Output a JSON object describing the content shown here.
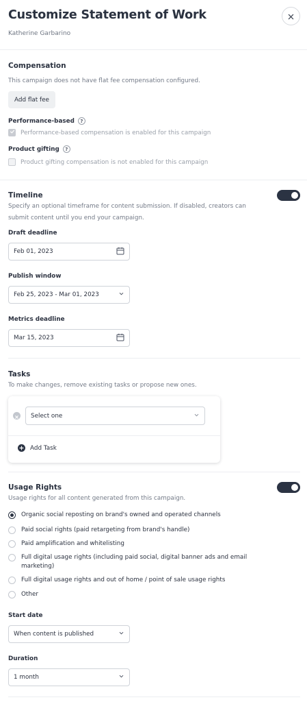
{
  "header": {
    "title": "Customize Statement of Work",
    "subtitle": "Katherine Garbarino"
  },
  "compensation": {
    "heading": "Compensation",
    "note": "This campaign does not have flat fee compensation configured.",
    "add_flat_fee_label": "Add flat fee",
    "performance_label": "Performance-based",
    "performance_status": "Performance-based compensation is enabled for this campaign",
    "gifting_label": "Product gifting",
    "gifting_status": "Product gifting compensation is not enabled for this campaign",
    "help_glyph": "?"
  },
  "timeline": {
    "heading": "Timeline",
    "enabled": true,
    "description_line1": "Specify an optional timeframe for content submission. If disabled, creators can",
    "description_line2": "submit content until you end your campaign.",
    "draft_label": "Draft deadline",
    "draft_value": "Feb 01, 2023",
    "publish_label": "Publish window",
    "publish_value": "Feb 25, 2023 - Mar 01, 2023",
    "metrics_label": "Metrics deadline",
    "metrics_value": "Mar 15, 2023"
  },
  "tasks": {
    "heading": "Tasks",
    "description": "To make changes, remove existing tasks or propose new ones.",
    "select_value": "Select one",
    "add_task_label": "Add Task"
  },
  "usage_rights": {
    "heading": "Usage Rights",
    "enabled": true,
    "description": "Usage rights for all content generated from this campaign.",
    "selected_index": 0,
    "options": [
      "Organic social reposting on brand's owned and operated channels",
      "Paid social rights (paid retargeting from brand's handle)",
      "Paid amplification and whitelisting",
      "Full digital usage rights (including paid social, digital banner ads and email marketing)",
      "Full digital usage rights and out of home / point of sale usage rights",
      "Other"
    ],
    "start_label": "Start date",
    "start_value": "When content is published",
    "duration_label": "Duration",
    "duration_value": "1 month"
  },
  "icons": {
    "close": "close-icon",
    "calendar": "calendar-icon",
    "chevron": "chevron-down-icon",
    "plus": "plus-circle-icon",
    "remove": "remove-circle-icon",
    "check": "checkmark-icon"
  },
  "colors": {
    "primary": "#2b3343",
    "muted_text": "#737a87",
    "border": "#cfd3d9"
  }
}
